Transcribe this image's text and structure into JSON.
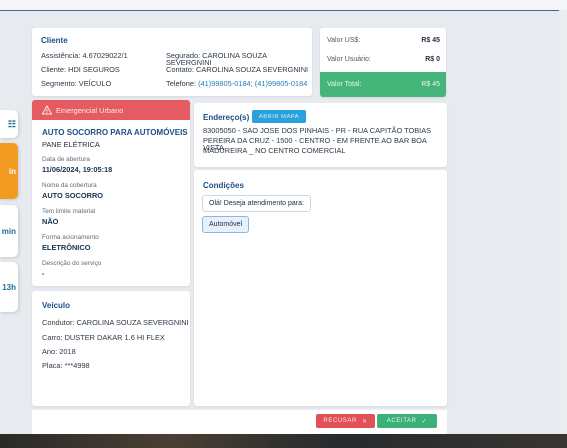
{
  "cliente": {
    "title": "Cliente",
    "assistencia": "Assistência: 4.67029022/1",
    "cliente": "Cliente: HDI SEGUROS",
    "segmento": "Segmento: VEÍCULO",
    "segurado": "Segurado: CAROLINA SOUZA SEVERGNINI",
    "contato": "Contato: CAROLINA SOUZA SEVERGNINI",
    "telefone_label": "Telefone:",
    "telefone_value": "(41)99805-0184; (41)99805-0184"
  },
  "valores": {
    "usd_label": "Valor US$:",
    "usd_value": "R$ 45",
    "usuario_label": "Valor Usuário:",
    "usuario_value": "R$ 0",
    "total_label": "Valor Total:",
    "total_value": "R$ 45"
  },
  "side_tabs": [
    "",
    "",
    "min",
    "13h"
  ],
  "emergencia": {
    "header": "Emergencial Urbano",
    "servico": "AUTO SOCORRO PARA AUTOMÓVEIS",
    "sub": "PANE ELÉTRICA",
    "data_label": "Data de abertura",
    "data_value": "11/06/2024, 19:05:18",
    "cobertura_label": "Nome da cobertura",
    "cobertura_value": "AUTO SOCORRO",
    "limite_label": "Tem limite material",
    "limite_value": "NÃO",
    "forma_label": "Forma acionamento",
    "forma_value": "ELETRÔNICO",
    "descricao_label": "Descrição do serviço",
    "descricao_value": "-"
  },
  "veiculo": {
    "title": "Veículo",
    "condutor": "Condutor: CAROLINA SOUZA SEVERGNINI",
    "carro": "Carro: DUSTER DAKAR 1.6 HI FLEX",
    "ano": "Ano: 2018",
    "placa": "Placa: ***4998"
  },
  "endereco": {
    "title": "Endereço(s)",
    "button": "ABRIR MAPA",
    "line1": "83005050 - SAO JOSE DOS PINHAIS - PR - RUA CAPITÃO TOBIAS",
    "line2": "PEREIRA DA CRUZ - 1500 - CENTRO - EM FRENTE AO BAR BOA VISTA",
    "line3": "MADUREIRA _ NO CENTRO COMERCIAL"
  },
  "condicoes": {
    "title": "Condições",
    "question": "Olá! Deseja atendimento para:",
    "option": "Automóvel"
  },
  "footer": {
    "recusar": "RECUSAR",
    "aceitar": "ACEITAR"
  },
  "colors": {
    "accent_blue": "#2aa0dc",
    "danger": "#e55b62",
    "success": "#45b57a",
    "warning_tab": "#f39a21"
  }
}
